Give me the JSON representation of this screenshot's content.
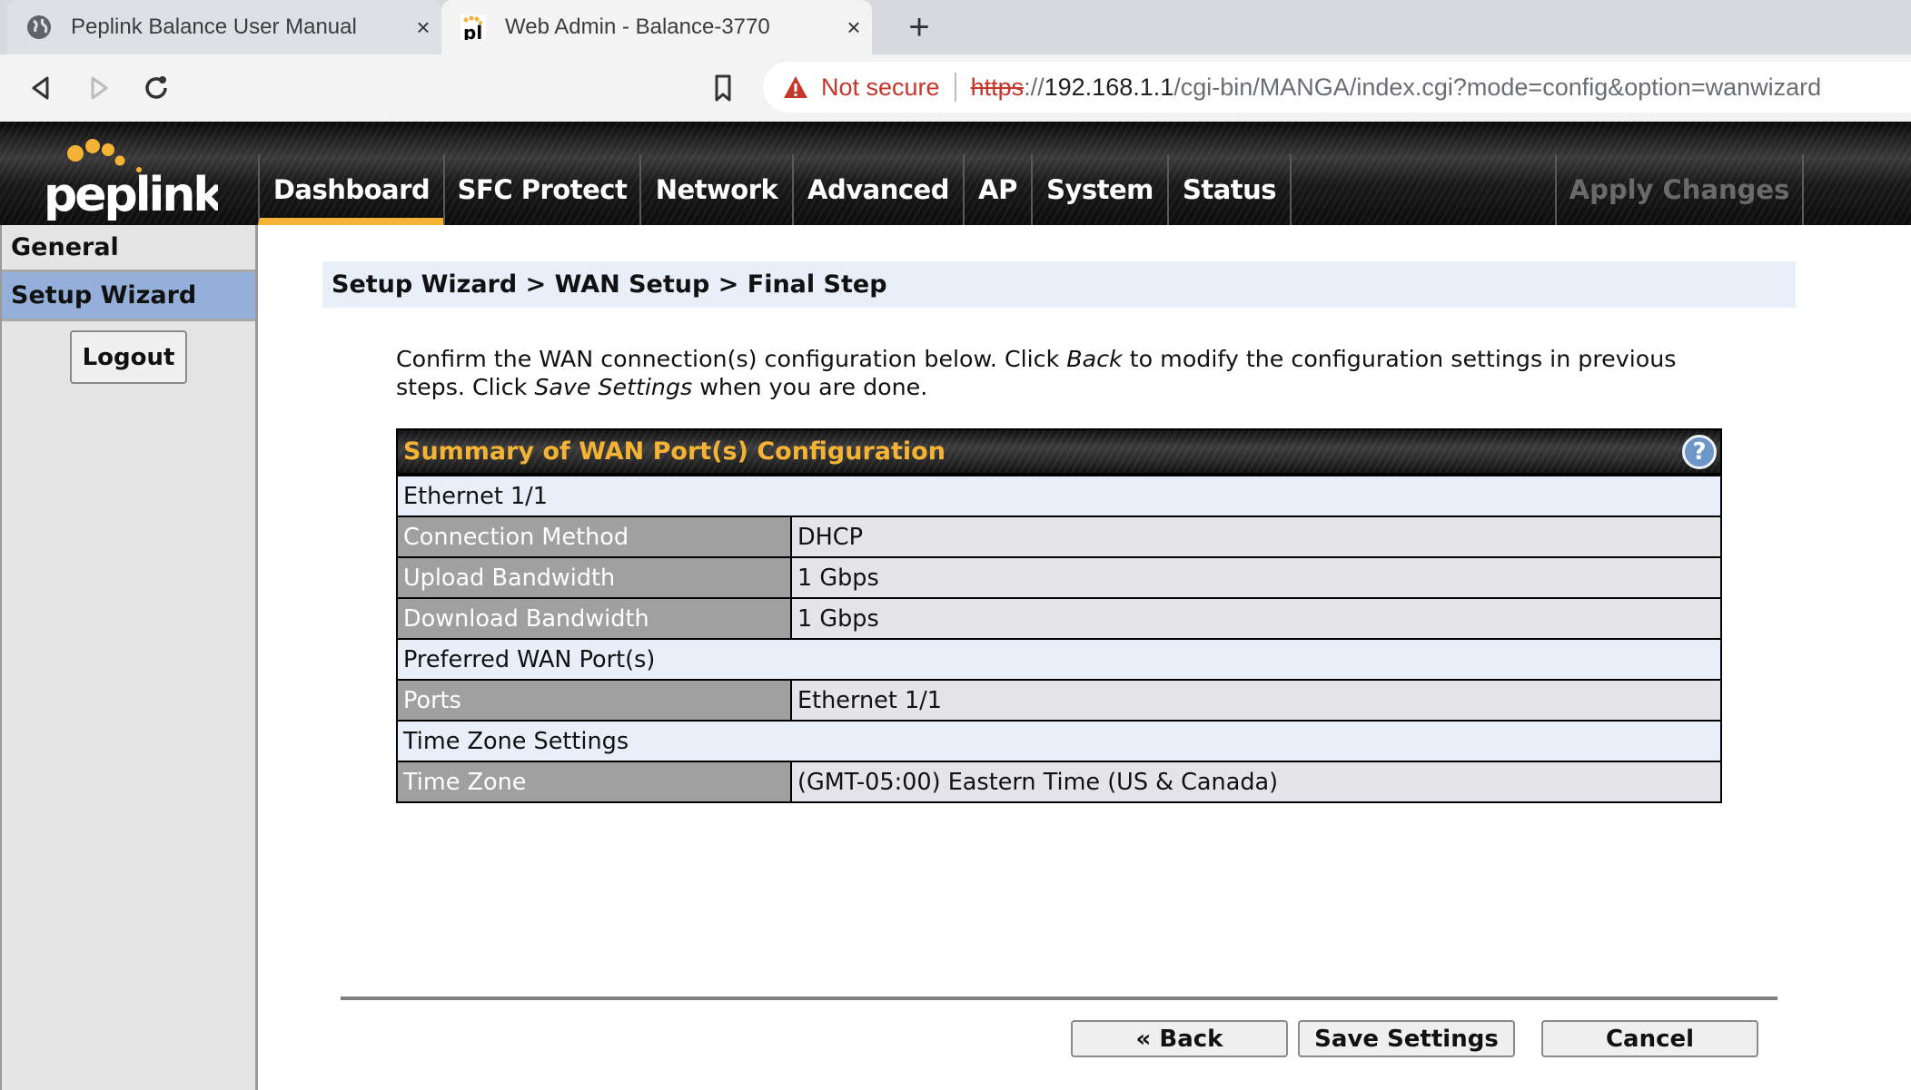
{
  "browser": {
    "tabs": [
      {
        "title": "Peplink Balance User Manual",
        "icon": "globe-icon",
        "active": false
      },
      {
        "title": "Web Admin - Balance-3770",
        "icon": "peplink-favicon",
        "active": true
      }
    ],
    "close_glyph": "×",
    "new_tab_glyph": "+",
    "address": {
      "security_label": "Not secure",
      "scheme": "https",
      "scheme_sep": "://",
      "host": "192.168.1.1",
      "path": "/cgi-bin/MANGA/index.cgi?mode=config&option=wanwizard"
    }
  },
  "app": {
    "brand": "peplink",
    "brand_accent": "#f5b335",
    "nav": [
      {
        "label": "Dashboard",
        "active": true
      },
      {
        "label": "SFC Protect",
        "active": false
      },
      {
        "label": "Network",
        "active": false
      },
      {
        "label": "Advanced",
        "active": false
      },
      {
        "label": "AP",
        "active": false
      },
      {
        "label": "System",
        "active": false
      },
      {
        "label": "Status",
        "active": false
      }
    ],
    "apply_changes": "Apply Changes"
  },
  "sidebar": {
    "items": [
      {
        "label": "General",
        "selected": false
      },
      {
        "label": "Setup Wizard",
        "selected": true
      }
    ],
    "logout": "Logout"
  },
  "main": {
    "breadcrumb": "Setup Wizard > WAN Setup > Final Step",
    "intro": {
      "p1": "Confirm the WAN connection(s) configuration below. Click ",
      "em1": "Back",
      "p2": " to modify the configuration settings in previous steps. Click ",
      "em2": "Save Settings",
      "p3": " when you are done."
    },
    "summary": {
      "title": "Summary of WAN Port(s) Configuration",
      "help_glyph": "?",
      "sections": [
        {
          "heading": "Ethernet 1/1",
          "rows": [
            {
              "label": "Connection Method",
              "value": "DHCP"
            },
            {
              "label": "Upload Bandwidth",
              "value": "1 Gbps"
            },
            {
              "label": "Download Bandwidth",
              "value": "1 Gbps"
            }
          ]
        },
        {
          "heading": "Preferred WAN Port(s)",
          "rows": [
            {
              "label": "Ports",
              "value": "Ethernet 1/1"
            }
          ]
        },
        {
          "heading": "Time Zone Settings",
          "rows": [
            {
              "label": "Time Zone",
              "value": "(GMT-05:00) Eastern Time (US & Canada)"
            }
          ]
        }
      ]
    },
    "buttons": {
      "back": "« Back",
      "save": "Save Settings",
      "cancel": "Cancel"
    }
  }
}
